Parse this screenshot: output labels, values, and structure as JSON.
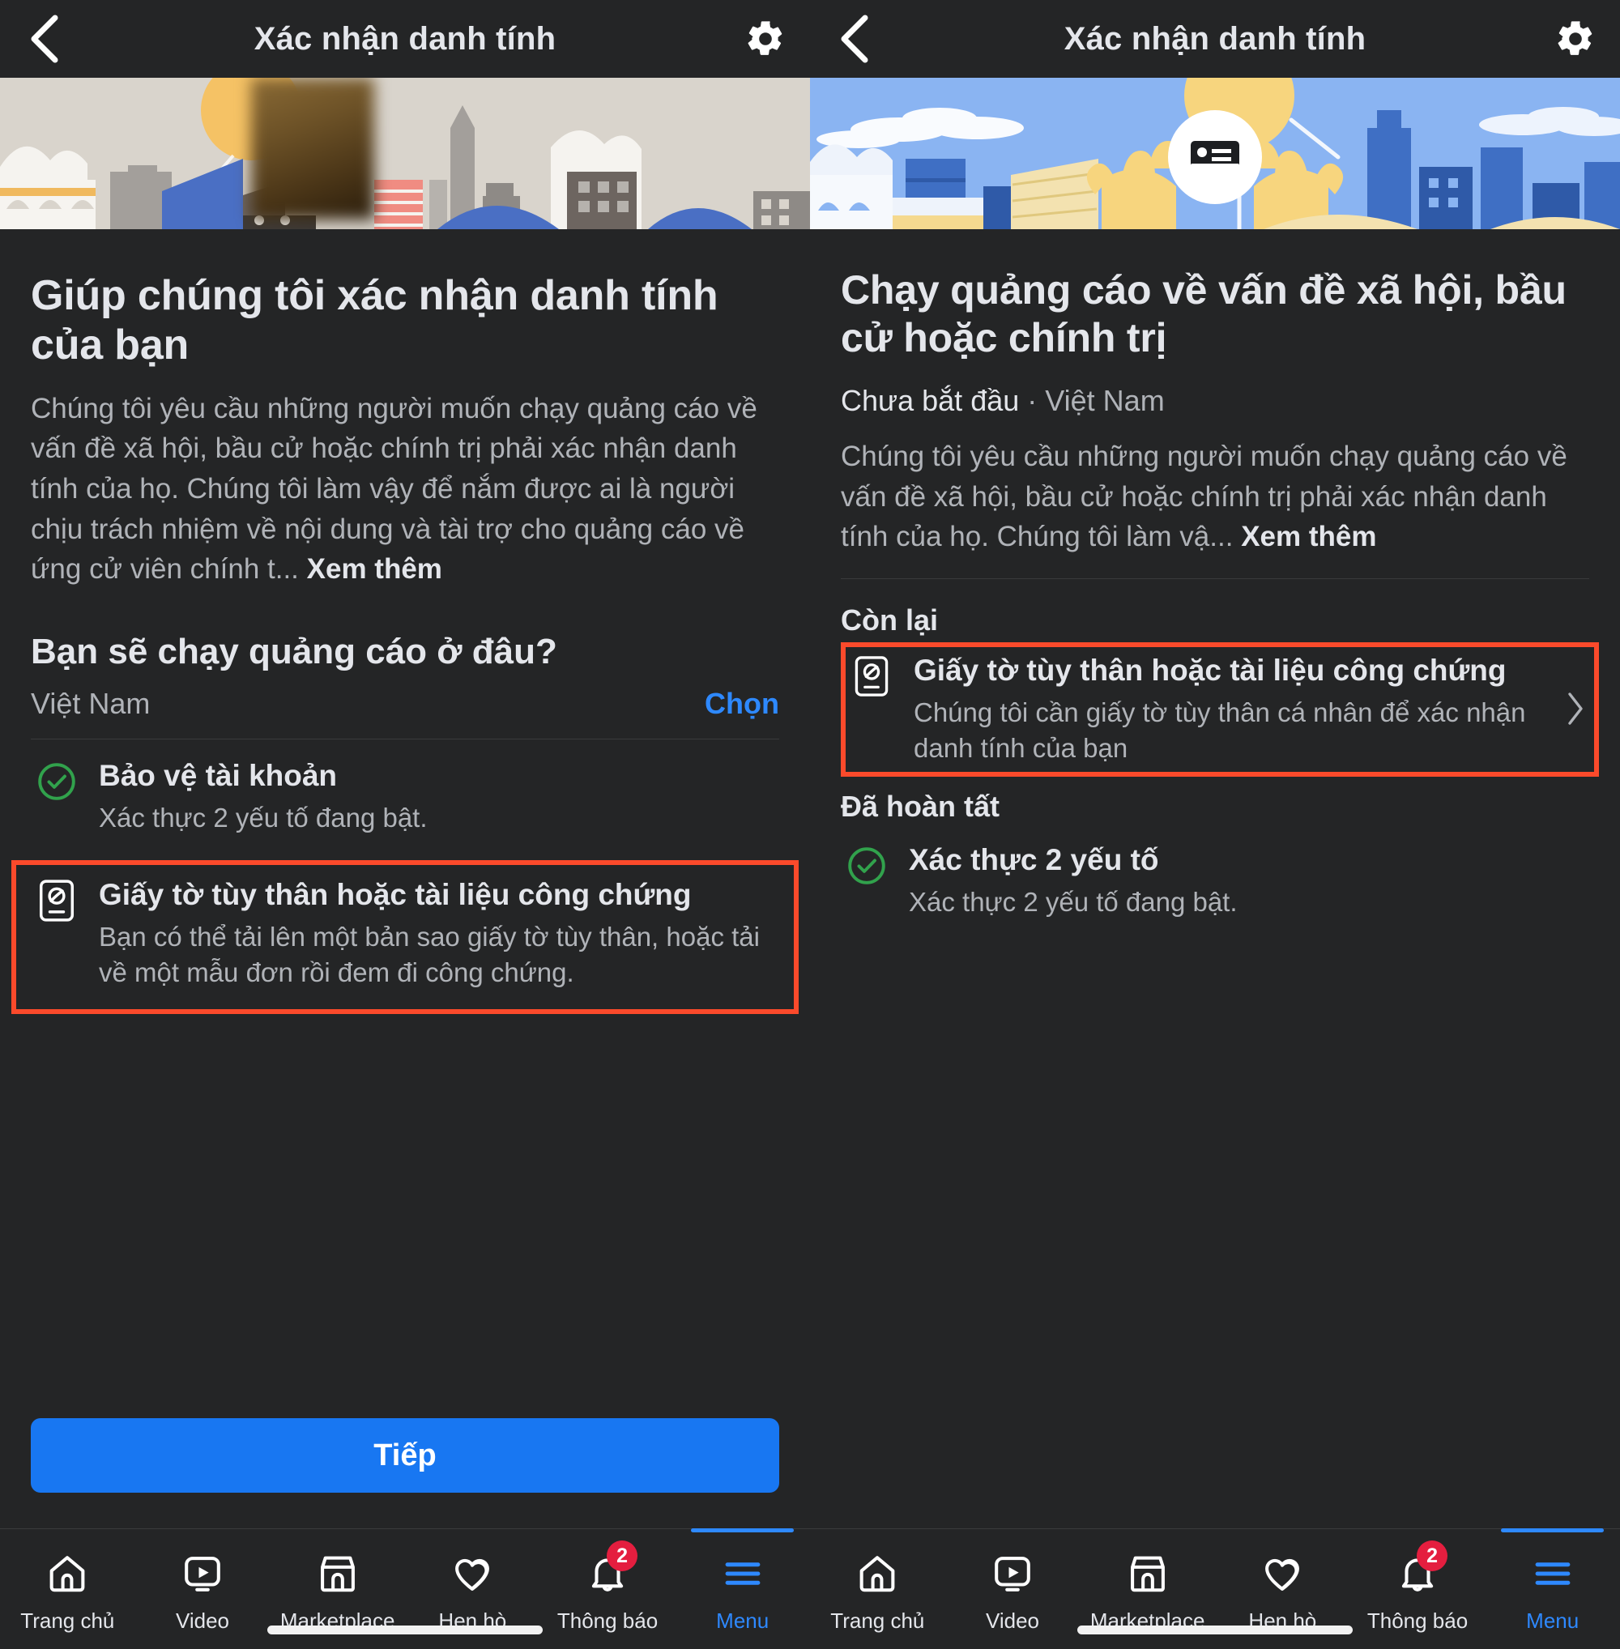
{
  "brand": {
    "accent_blue": "#1877f2",
    "link_blue": "#2e89ff",
    "highlight_orange": "#fb4a2b",
    "success_green": "#31a24c",
    "badge_red": "#e41e3f",
    "bg_dark": "#242526",
    "text_primary": "#e4e6eb",
    "text_secondary": "#b0b3b8"
  },
  "left": {
    "header": {
      "title": "Xác nhận danh tính",
      "back_icon": "chevron-left-icon",
      "settings_icon": "gear-icon"
    },
    "hero_alt": "city-skyline-illustration",
    "heading": "Giúp chúng tôi xác nhận danh tính của bạn",
    "paragraph": "Chúng tôi yêu cầu những người muốn chạy quảng cáo về vấn đề xã hội, bầu cử hoặc chính trị phải xác nhận danh tính của họ. Chúng tôi làm vậy để nắm được ai là người chịu trách nhiệm về nội dung và tài trợ cho quảng cáo về ứng cử viên chính t...",
    "see_more": "Xem thêm",
    "question": "Bạn sẽ chạy quảng cáo ở đâu?",
    "country_value": "Việt Nam",
    "country_action": "Chọn",
    "items": [
      {
        "icon": "check-circle-icon",
        "title": "Bảo vệ tài khoản",
        "subtitle": "Xác thực 2 yếu tố đang bật.",
        "highlighted": false
      },
      {
        "icon": "id-document-icon",
        "title": "Giấy tờ tùy thân hoặc tài liệu công chứng",
        "subtitle": "Bạn có thể tải lên một bản sao giấy tờ tùy thân, hoặc tải về một mẫu đơn rồi đem đi công chứng.",
        "highlighted": true
      }
    ],
    "cta": "Tiếp"
  },
  "right": {
    "header": {
      "title": "Xác nhận danh tính",
      "back_icon": "chevron-left-icon",
      "settings_icon": "gear-icon"
    },
    "hero_alt": "hands-holding-id-card-illustration",
    "heading": "Chạy quảng cáo về vấn đề xã hội, bầu cử hoặc chính trị",
    "status": "Chưa bắt đầu",
    "status_separator": "·",
    "location": "Việt Nam",
    "paragraph": "Chúng tôi yêu cầu những người muốn chạy quảng cáo về vấn đề xã hội, bầu cử hoặc chính trị phải xác nhận danh tính của họ. Chúng tôi làm vậ...",
    "see_more": "Xem thêm",
    "section_remaining": "Còn lại",
    "section_completed": "Đã hoàn tất",
    "remaining_items": [
      {
        "icon": "id-document-icon",
        "title": "Giấy tờ tùy thân hoặc tài liệu công chứng",
        "subtitle": "Chúng tôi cần giấy tờ tùy thân cá nhân để xác nhận danh tính của bạn",
        "caret": "chevron-right-icon",
        "highlighted": true
      }
    ],
    "completed_items": [
      {
        "icon": "check-circle-icon",
        "title": "Xác thực 2 yếu tố",
        "subtitle": "Xác thực 2 yếu tố đang bật.",
        "highlighted": false
      }
    ]
  },
  "tabbar": {
    "items": [
      {
        "label": "Trang chủ",
        "icon": "home-icon",
        "badge": "",
        "active": false
      },
      {
        "label": "Video",
        "icon": "video-icon",
        "badge": "",
        "active": false
      },
      {
        "label": "Marketplace",
        "icon": "marketplace-icon",
        "badge": "",
        "active": false
      },
      {
        "label": "Hẹn hò",
        "icon": "dating-heart-icon",
        "badge": "",
        "active": false
      },
      {
        "label": "Thông báo",
        "icon": "bell-icon",
        "badge": "2",
        "active": false
      },
      {
        "label": "Menu",
        "icon": "hamburger-icon",
        "badge": "",
        "active": true
      }
    ]
  }
}
